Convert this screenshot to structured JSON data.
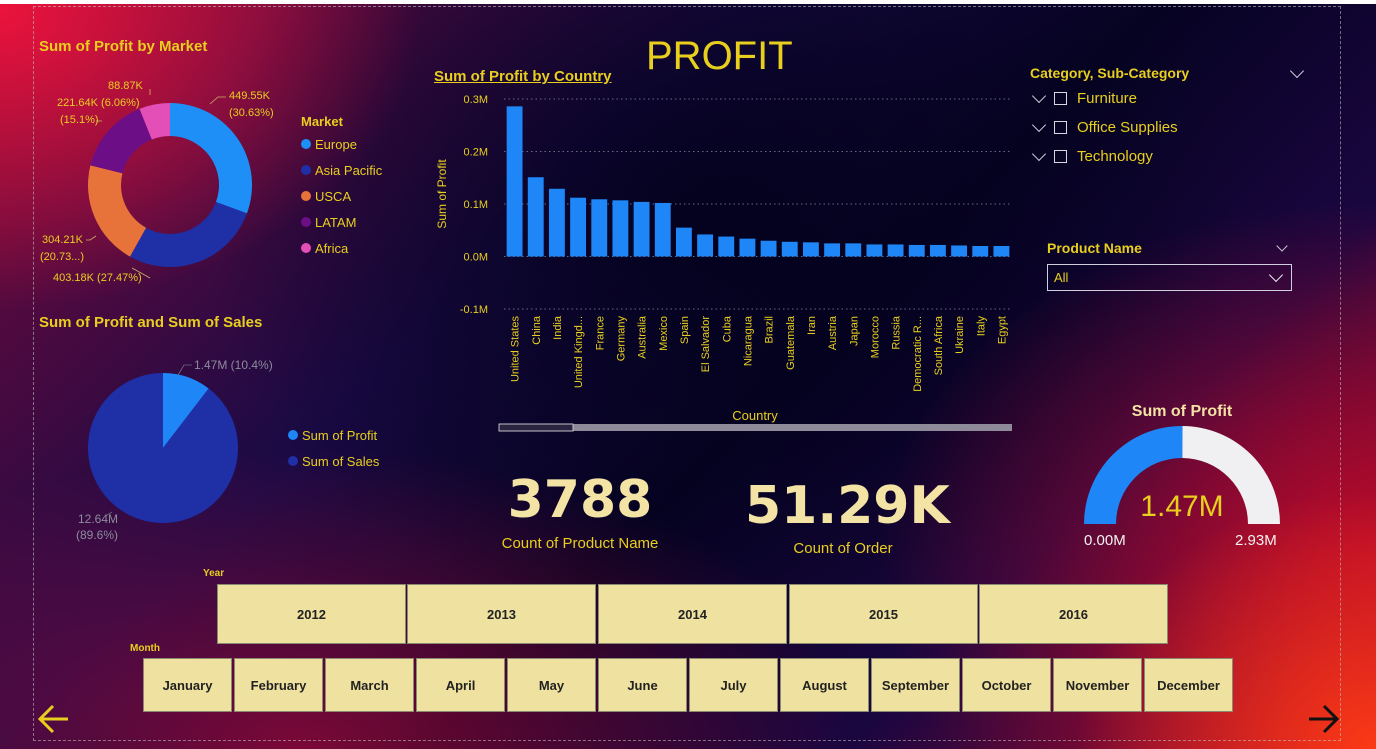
{
  "page_title": "PROFIT",
  "colors": {
    "accent": "#e8cf1e",
    "bar": "#1e86f7",
    "europe": "#1e8ff7",
    "asia_pacific": "#1f2fa6",
    "usca": "#e8733a",
    "latam": "#6c0f87",
    "africa": "#e34fb6"
  },
  "market_chart": {
    "title": "Sum of Profit by Market",
    "legend_title": "Market",
    "legend": [
      {
        "name": "Europe",
        "color": "#1e8ff7"
      },
      {
        "name": "Asia Pacific",
        "color": "#1f2fa6"
      },
      {
        "name": "USCA",
        "color": "#e8733a"
      },
      {
        "name": "LATAM",
        "color": "#6c0f87"
      },
      {
        "name": "Africa",
        "color": "#e34fb6"
      }
    ],
    "labels": {
      "europe_1": "449.55K",
      "europe_2": "(30.63%)",
      "asia": "403.18K (27.47%)",
      "usca_1": "304.21K",
      "usca_2": "(20.73...)",
      "latam_1": "221.64K (6.06%)",
      "latam_2": "(15.1%)",
      "africa": "88.87K"
    }
  },
  "profit_sales_chart": {
    "title": "Sum of Profit and Sum of Sales",
    "legend": [
      {
        "name": "Sum of Profit",
        "color": "#1e86f7"
      },
      {
        "name": "Sum of Sales",
        "color": "#1f2fa6"
      }
    ],
    "labels": {
      "profit": "1.47M (10.4%)",
      "sales_1": "12.64M",
      "sales_2": "(89.6%)"
    }
  },
  "chart_data": [
    {
      "type": "pie",
      "title": "Sum of Profit by Market",
      "categories": [
        "Europe",
        "Asia Pacific",
        "USCA",
        "LATAM",
        "Africa"
      ],
      "values": [
        449.55,
        403.18,
        304.21,
        221.64,
        88.87
      ],
      "unit": "K"
    },
    {
      "type": "bar",
      "title": "Sum of Profit by Country",
      "xlabel": "Country",
      "ylabel": "Sum of Profit",
      "ylim": [
        -0.1,
        0.3
      ],
      "yticks": [
        "0.3M",
        "0.2M",
        "0.1M",
        "0.0M",
        "-0.1M"
      ],
      "categories": [
        "United States",
        "China",
        "India",
        "United Kingd...",
        "France",
        "Germany",
        "Australia",
        "Mexico",
        "Spain",
        "El Salvador",
        "Cuba",
        "Nicaragua",
        "Brazil",
        "Guatemala",
        "Iran",
        "Austria",
        "Japan",
        "Morocco",
        "Russia",
        "Democratic R...",
        "South Africa",
        "Ukraine",
        "Italy",
        "Egypt"
      ],
      "values": [
        0.286,
        0.151,
        0.129,
        0.112,
        0.109,
        0.107,
        0.104,
        0.102,
        0.055,
        0.042,
        0.038,
        0.034,
        0.03,
        0.028,
        0.027,
        0.025,
        0.025,
        0.023,
        0.023,
        0.022,
        0.022,
        0.021,
        0.02,
        0.02
      ]
    },
    {
      "type": "pie",
      "title": "Sum of Profit and Sum of Sales",
      "categories": [
        "Sum of Profit",
        "Sum of Sales"
      ],
      "values": [
        1.47,
        12.64
      ],
      "unit": "M"
    }
  ],
  "country_chart": {
    "title": "Sum of Profit by Country",
    "xlabel": "Country",
    "ylabel": "Sum of Profit"
  },
  "filters": {
    "category_title": "Category, Sub-Category",
    "categories": [
      "Furniture",
      "Office Supplies",
      "Technology"
    ],
    "product_title": "Product Name",
    "product_value": "All"
  },
  "kpis": {
    "product_count": "3788",
    "product_label": "Count of Product Name",
    "order_count": "51.29K",
    "order_label": "Count of Order"
  },
  "gauge": {
    "title": "Sum of Profit",
    "value": "1.47M",
    "min": "0.00M",
    "max": "2.93M",
    "fraction": 0.5017
  },
  "year_slicer": {
    "title": "Year",
    "items": [
      "2012",
      "2013",
      "2014",
      "2015",
      "2016"
    ]
  },
  "month_slicer": {
    "title": "Month",
    "items": [
      "January",
      "February",
      "March",
      "April",
      "May",
      "June",
      "July",
      "August",
      "September",
      "October",
      "November",
      "December"
    ]
  }
}
